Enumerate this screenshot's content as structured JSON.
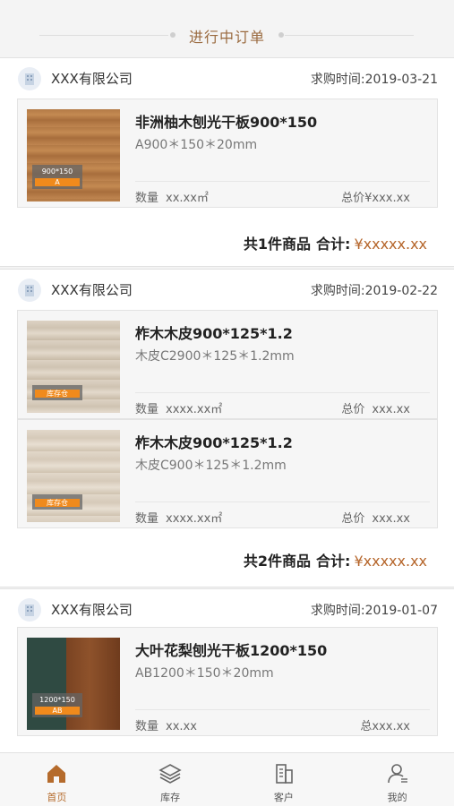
{
  "header": {
    "title": "进行中订单"
  },
  "orders": [
    {
      "company": "XXX有限公司",
      "date": "求购时间:2019-03-21",
      "products": [
        {
          "name": "非洲柚木刨光干板900*150",
          "spec": "A900＊150＊20mm",
          "qty_label": "数量",
          "qty_value": "xx.xx㎡",
          "price_label": "总价",
          "price_value": "¥xxx.xx",
          "thumb_size": "900*150",
          "thumb_grade": "A"
        }
      ],
      "summary_count": "共1件商品",
      "summary_label": "合计:",
      "summary_amount": "¥xxxxx.xx"
    },
    {
      "company": "XXX有限公司",
      "date": "求购时间:2019-02-22",
      "products": [
        {
          "name": "柞木木皮900*125*1.2",
          "spec": "木皮C2900＊125＊1.2mm",
          "qty_label": "数量",
          "qty_value": "xxxx.xx㎡",
          "price_label": "总价",
          "price_value": "xxx.xx",
          "thumb_size": "",
          "thumb_grade": "库存仓"
        },
        {
          "name": "柞木木皮900*125*1.2",
          "spec": "木皮C900＊125＊1.2mm",
          "qty_label": "数量",
          "qty_value": "xxxx.xx㎡",
          "price_label": "总价",
          "price_value": "xxx.xx",
          "thumb_size": "",
          "thumb_grade": "库存仓"
        }
      ],
      "summary_count": "共2件商品",
      "summary_label": "合计:",
      "summary_amount": "¥xxxxx.xx"
    },
    {
      "company": "XXX有限公司",
      "date": "求购时间:2019-01-07",
      "products": [
        {
          "name": "大叶花梨刨光干板1200*150",
          "spec": "AB1200＊150＊20mm",
          "qty_label": "数量",
          "qty_value": "xx.xx",
          "price_label": "总",
          "price_value": "xxx.xx",
          "thumb_size": "1200*150",
          "thumb_grade": "AB"
        }
      ]
    }
  ],
  "nav": [
    {
      "label": "首页",
      "icon": "home-icon",
      "active": true
    },
    {
      "label": "库存",
      "icon": "layers-icon",
      "active": false
    },
    {
      "label": "客户",
      "icon": "building-icon",
      "active": false
    },
    {
      "label": "我的",
      "icon": "user-icon",
      "active": false
    }
  ],
  "colors": {
    "accent": "#b56b2c",
    "price": "#b5652a",
    "header_title": "#9a6a3f"
  }
}
